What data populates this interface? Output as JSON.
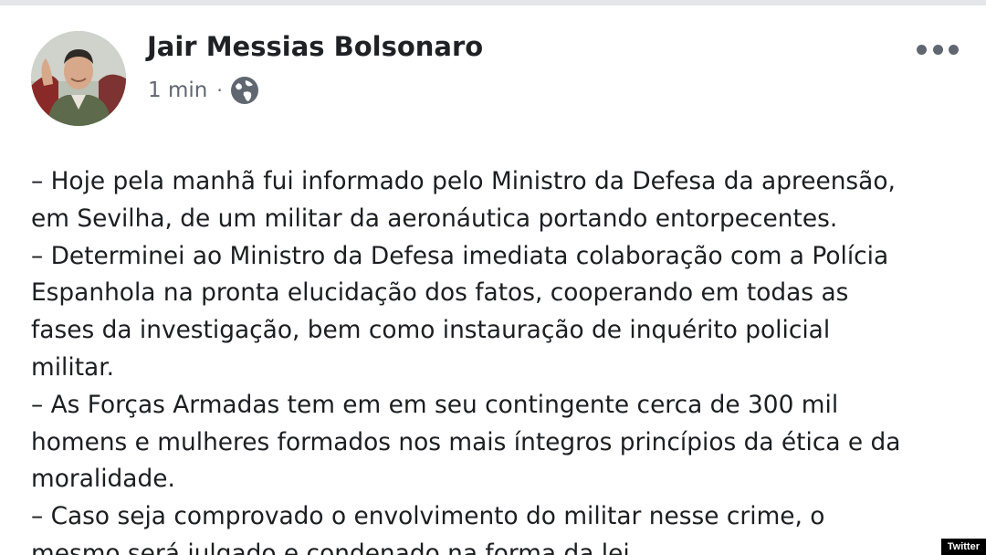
{
  "post": {
    "author": "Jair Messias Bolsonaro",
    "timestamp": "1 min",
    "separator": "·",
    "privacy_icon": "globe-icon",
    "more_icon": "more-options-icon",
    "lines": [
      "– Hoje pela manhã fui informado pelo Ministro da Defesa da apreensão,",
      "em Sevilha, de um militar da aeronáutica portando entorpecentes.",
      "– Determinei ao Ministro da Defesa imediata colaboração com a Polícia",
      "Espanhola na pronta elucidação dos fatos, cooperando em todas as",
      "fases da investigação, bem como instauração de inquérito policial",
      "militar.",
      "– As Forças Armadas tem em  em seu contingente  cerca de 300 mil",
      "homens e mulheres  formados nos mais íntegros princípios da ética e da",
      "moralidade.",
      "– Caso seja comprovado o envolvimento do militar nesse crime, o",
      "mesmo será julgado e condenado na forma da lei."
    ]
  },
  "watermark": {
    "label": "Twitter"
  },
  "colors": {
    "author": "#1f2124",
    "meta": "#606770",
    "body_text": "#1c1e21",
    "background": "#ffffff"
  }
}
